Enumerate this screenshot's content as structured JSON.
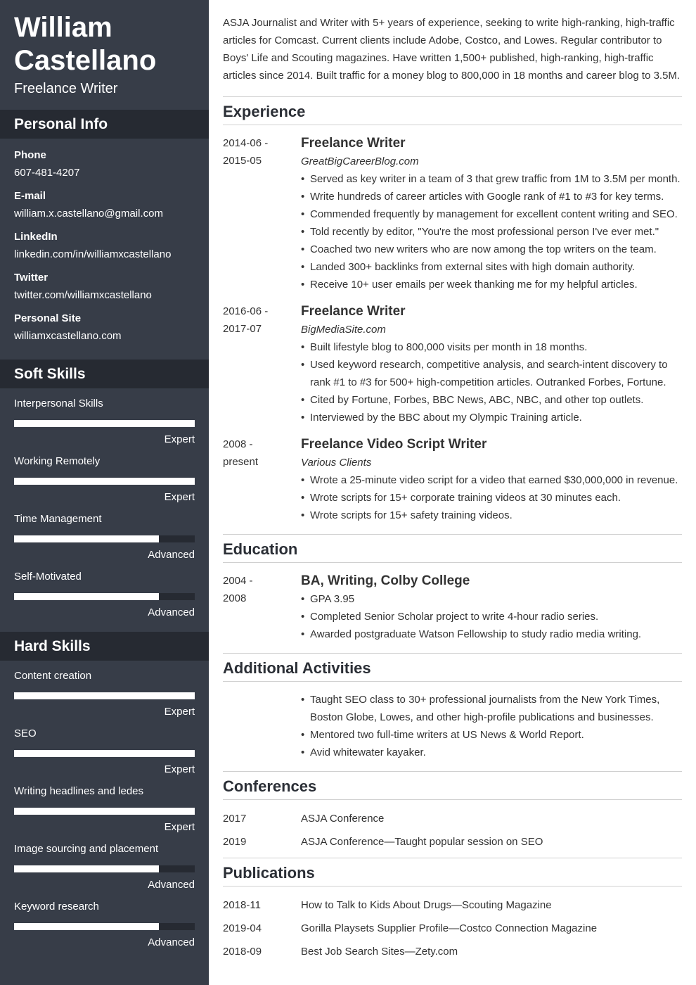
{
  "header": {
    "name_line1": "William",
    "name_line2": "Castellano",
    "title": "Freelance Writer"
  },
  "sidebar": {
    "personal_info": {
      "heading": "Personal Info",
      "items": [
        {
          "label": "Phone",
          "value": "607-481-4207"
        },
        {
          "label": "E-mail",
          "value": "william.x.castellano@gmail.com"
        },
        {
          "label": "LinkedIn",
          "value": "linkedin.com/in/williamxcastellano"
        },
        {
          "label": "Twitter",
          "value": "twitter.com/williamxcastellano"
        },
        {
          "label": "Personal Site",
          "value": "williamxcastellano.com"
        }
      ]
    },
    "soft_skills": {
      "heading": "Soft Skills",
      "items": [
        {
          "name": "Interpersonal Skills",
          "level": "Expert",
          "fraction": 1.0
        },
        {
          "name": "Working Remotely",
          "level": "Expert",
          "fraction": 1.0
        },
        {
          "name": "Time Management",
          "level": "Advanced",
          "fraction": 0.8
        },
        {
          "name": "Self-Motivated",
          "level": "Advanced",
          "fraction": 0.8
        }
      ]
    },
    "hard_skills": {
      "heading": "Hard Skills",
      "items": [
        {
          "name": "Content creation",
          "level": "Expert",
          "fraction": 1.0
        },
        {
          "name": "SEO",
          "level": "Expert",
          "fraction": 1.0
        },
        {
          "name": "Writing headlines and ledes",
          "level": "Expert",
          "fraction": 1.0
        },
        {
          "name": "Image sourcing and placement",
          "level": "Advanced",
          "fraction": 0.8
        },
        {
          "name": "Keyword research",
          "level": "Advanced",
          "fraction": 0.8
        }
      ]
    }
  },
  "main": {
    "summary": "ASJA Journalist and Writer with 5+ years of experience, seeking to write high-ranking, high-traffic articles for Comcast. Current clients include Adobe, Costco, and Lowes. Regular contributor to Boys' Life and Scouting magazines. Have written 1,500+ published, high-ranking, high-traffic articles since 2014. Built traffic for a money blog to 800,000 in 18 months and career blog to 3.5M.",
    "experience": {
      "heading": "Experience",
      "entries": [
        {
          "date_start": "2014-06 -",
          "date_end": "2015-05",
          "title": "Freelance Writer",
          "company": "GreatBigCareerBlog.com",
          "bullets": [
            "Served as key writer in a team of 3 that grew traffic from 1M to 3.5M per month.",
            "Write hundreds of career articles with Google rank of #1 to #3 for key terms.",
            "Commended frequently by management for excellent content writing and SEO.",
            "Told recently by editor, \"You're the most professional person I've ever met.\"",
            "Coached two new writers who are now among the top writers on the team.",
            "Landed 300+ backlinks from external sites with high domain authority.",
            "Receive 10+ user emails per week thanking me for my helpful articles."
          ]
        },
        {
          "date_start": "2016-06 -",
          "date_end": "2017-07",
          "title": "Freelance Writer",
          "company": "BigMediaSite.com",
          "bullets": [
            "Built lifestyle blog to 800,000 visits per month in 18 months.",
            "Used keyword research, competitive analysis, and search-intent discovery to rank #1 to #3 for 500+ high-competition articles. Outranked Forbes, Fortune.",
            "Cited by Fortune, Forbes, BBC News, ABC, NBC, and other top outlets.",
            "Interviewed by the BBC about my Olympic Training article."
          ]
        },
        {
          "date_start": "2008 -",
          "date_end": "present",
          "title": "Freelance Video Script Writer",
          "company": "Various Clients",
          "bullets": [
            "Wrote a 25-minute video script for a video that earned $30,000,000 in revenue.",
            "Wrote scripts for 15+ corporate training videos at 30 minutes each.",
            "Wrote scripts for 15+ safety training videos."
          ]
        }
      ]
    },
    "education": {
      "heading": "Education",
      "entries": [
        {
          "date_start": "2004 -",
          "date_end": "2008",
          "title": "BA, Writing, Colby College",
          "bullets": [
            "GPA 3.95",
            "Completed Senior Scholar project to write 4-hour radio series.",
            "Awarded postgraduate Watson Fellowship to study radio media writing."
          ]
        }
      ]
    },
    "activities": {
      "heading": "Additional Activities",
      "bullets": [
        "Taught SEO class to 30+ professional journalists from the New York Times, Boston Globe, Lowes, and other high-profile publications and businesses.",
        "Mentored two full-time writers at US News & World Report.",
        "Avid whitewater kayaker."
      ]
    },
    "conferences": {
      "heading": "Conferences",
      "items": [
        {
          "date": "2017",
          "text": "ASJA Conference"
        },
        {
          "date": "2019",
          "text": "ASJA Conference—Taught popular session on SEO"
        }
      ]
    },
    "publications": {
      "heading": "Publications",
      "items": [
        {
          "date": "2018-11",
          "text": "How to Talk to Kids About Drugs—Scouting Magazine"
        },
        {
          "date": "2019-04",
          "text": "Gorilla Playsets Supplier Profile—Costco Connection Magazine"
        },
        {
          "date": "2018-09",
          "text": "Best Job Search Sites—Zety.com"
        }
      ]
    }
  }
}
